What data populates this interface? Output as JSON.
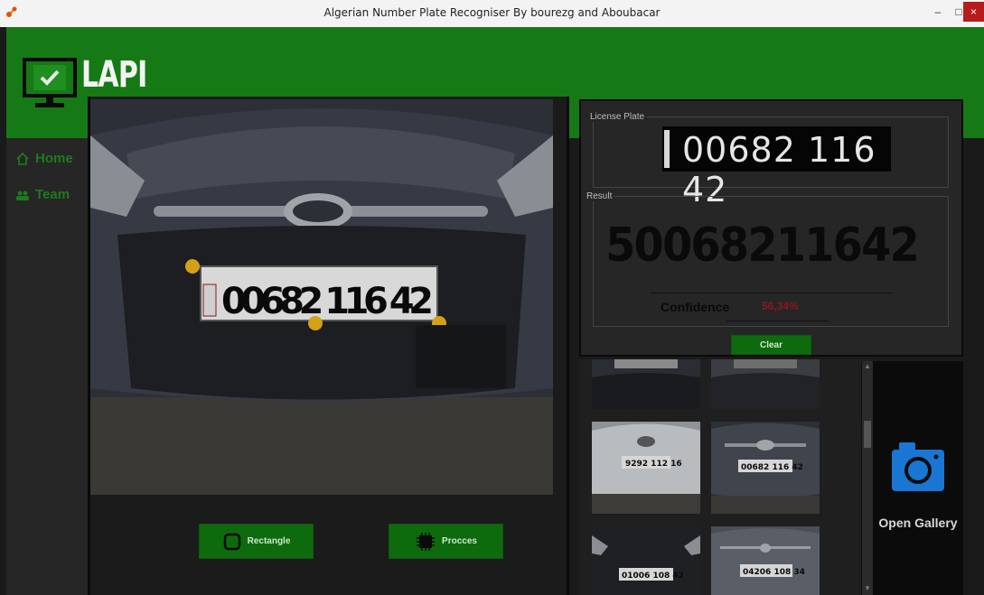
{
  "window": {
    "title": "Algerian Number Plate Recogniser By bourezg and Aboubacar",
    "minimize_glyph": "–",
    "maximize_glyph": "□",
    "close_glyph": "×"
  },
  "header": {
    "app_name": "LAPI",
    "logo_icon": "monitor-check-icon"
  },
  "sidebar": {
    "items": [
      {
        "label": "Home",
        "icon": "home-icon"
      },
      {
        "label": "Team",
        "icon": "users-icon"
      }
    ]
  },
  "work": {
    "car_plate_text": "00682 116 42",
    "rectangle_label": "Rectangle",
    "process_label": "Procces"
  },
  "result_panel": {
    "license_plate_title": "License Plate",
    "plate_crop_text": "00682 116 42",
    "result_title": "Result",
    "result_value": "50068211642",
    "confidence_label": "Confidence",
    "confidence_value": "56,34%",
    "clear_label": "Clear"
  },
  "gallery": {
    "thumbnails": [
      {
        "plate": ""
      },
      {
        "plate": ""
      },
      {
        "plate": "9292 112 16"
      },
      {
        "plate": "00682 116 42"
      },
      {
        "plate": "01006 108 42"
      },
      {
        "plate": "04206 108 34"
      }
    ],
    "open_gallery_label": "Open Gallery"
  },
  "colors": {
    "accent_green": "#157a15",
    "button_green": "#0d6b0d",
    "marker_yellow": "#d4a017",
    "camera_blue": "#1976d2",
    "confidence_red": "#8a1a1a"
  }
}
